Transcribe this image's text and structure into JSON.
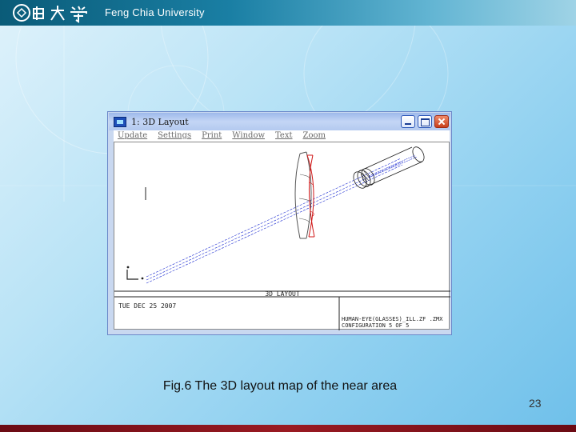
{
  "header": {
    "university_name": "Feng Chia University",
    "logo": "feng-chia-university-seal-and-chinese-name"
  },
  "window": {
    "title": "1: 3D Layout",
    "menu": [
      "Update",
      "Settings",
      "Print",
      "Window",
      "Text",
      "Zoom"
    ],
    "controls": [
      "minimize",
      "maximize",
      "close"
    ]
  },
  "plot": {
    "label": "3D LAYOUT",
    "date": "TUE DEC 25 2007",
    "file_info": "HUMAN-EYE(GLASSES)_ILL.ZF  .ZMX",
    "configuration": "CONFIGURATION 5 OF 5"
  },
  "slide": {
    "caption": "Fig.6 The 3D layout map of the near area",
    "page_number": "23"
  },
  "colors": {
    "header": "#1a7fa4",
    "footer": "#8a1420",
    "ray": "#1a2ad0",
    "lens_red": "#d01818"
  }
}
